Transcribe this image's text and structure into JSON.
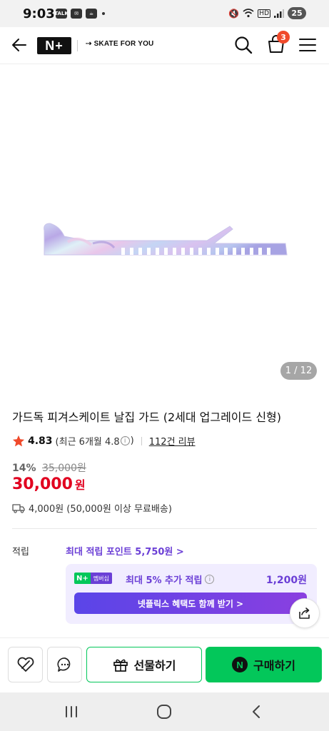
{
  "status_bar": {
    "time": "9:03",
    "left_icons": [
      "talk",
      "chat",
      "app"
    ],
    "battery": "25"
  },
  "header": {
    "logo": "N+",
    "store_name": "SKATE FOR YOU",
    "cart_count": "3"
  },
  "image": {
    "counter": "1 / 12"
  },
  "product": {
    "title": "가드독 피겨스케이트 날집 가드 (2세대 업그레이드 신형)",
    "rating": "4.83",
    "recent_rating_text": "(최근 6개월 4.8",
    "recent_rating_close": ")",
    "reviews": "112건 리뷰",
    "discount_rate": "14%",
    "original_price": "35,000원",
    "price": "30,000",
    "price_unit": "원",
    "shipping": "4,000원 (50,000원 이상 무료배송)"
  },
  "points": {
    "label": "적립",
    "max_points": "최대 적립 포인트 5,750원 >",
    "membership_badge_n": "N+",
    "membership_badge_text": "멤버십",
    "membership_desc": "최대 5% 추가 적립",
    "membership_amount": "1,200원",
    "netflix_button": "넷플릭스 혜택도 함께 받기 >"
  },
  "actions": {
    "gift": "선물하기",
    "buy": "구매하기",
    "npay_letter": "N"
  },
  "colors": {
    "accent_green": "#03c75a",
    "price_red": "#e1001f",
    "purple": "#6b3fd6"
  }
}
